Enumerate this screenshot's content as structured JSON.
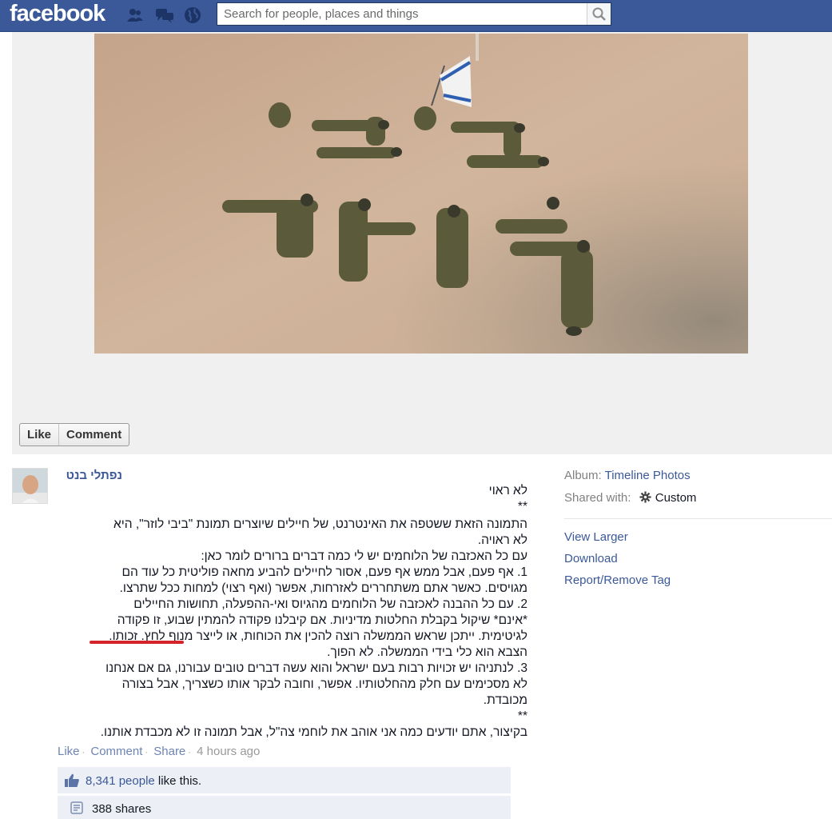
{
  "header": {
    "logo": "facebook",
    "search_placeholder": "Search for people, places and things"
  },
  "photo": {
    "like_label": "Like",
    "comment_label": "Comment"
  },
  "post": {
    "author": "נפתלי בנט",
    "lines": [
      "לא ראוי",
      "**",
      "התמונה הזאת ששטפה את האינטרנט, של חיילים שיוצרים תמונת \"ביבי לוזר\", היא",
      "לא ראויה.",
      "עם כל האכזבה של הלוחמים יש לי כמה דברים ברורים לומר כאן:",
      "1. אף פעם, אבל ממש אף פעם, אסור לחיילים להביע מחאה פוליטית כל עוד הם",
      "מגויסים. כאשר אתם משתחררים לאזרחות, אפשר (ואף רצוי) למחות ככל שתרצו.",
      "2. עם כל ההבנה לאכזבה של הלוחמים מהגיוס ואי-ההפעלה, תחושות החיילים",
      "*אינם* שיקול בקבלת החלטות מדיניות. אם קיבלנו פקודה להמתין שבוע, זו פקודה",
      "לגיטימית. ייתכן שראש הממשלה רוצה להכין את הכוחות, או לייצר מנוף לחץ. זכותו.",
      "הצבא הוא כלי בידי הממשלה. לא הפוך.",
      "3. לנתניהו יש זכויות רבות בעם ישראל והוא עשה דברים טובים עבורנו, גם אם אנחנו",
      "לא מסכימים עם חלק מהחלטותיו. אפשר, וחובה לבקר אותו כשצריך, אבל בצורה",
      "מכובדת.",
      "**",
      "בקיצור, אתם יודעים כמה אני אוהב את לוחמי צה\"ל, אבל תמונה זו לא מכבדת אותנו."
    ],
    "actions": {
      "like": "Like",
      "comment": "Comment",
      "share": "Share",
      "time": "4 hours ago"
    },
    "likes": {
      "count": "8,341 people",
      "suffix": " like this."
    },
    "shares": "388 shares"
  },
  "sidebar": {
    "album_label": "Album:",
    "album_value": "Timeline Photos",
    "shared_label": "Shared with:",
    "shared_value": "Custom",
    "links": [
      "View Larger",
      "Download",
      "Report/Remove Tag"
    ]
  },
  "colors": {
    "brand": "#3b5998",
    "underline": "#d4242a"
  }
}
